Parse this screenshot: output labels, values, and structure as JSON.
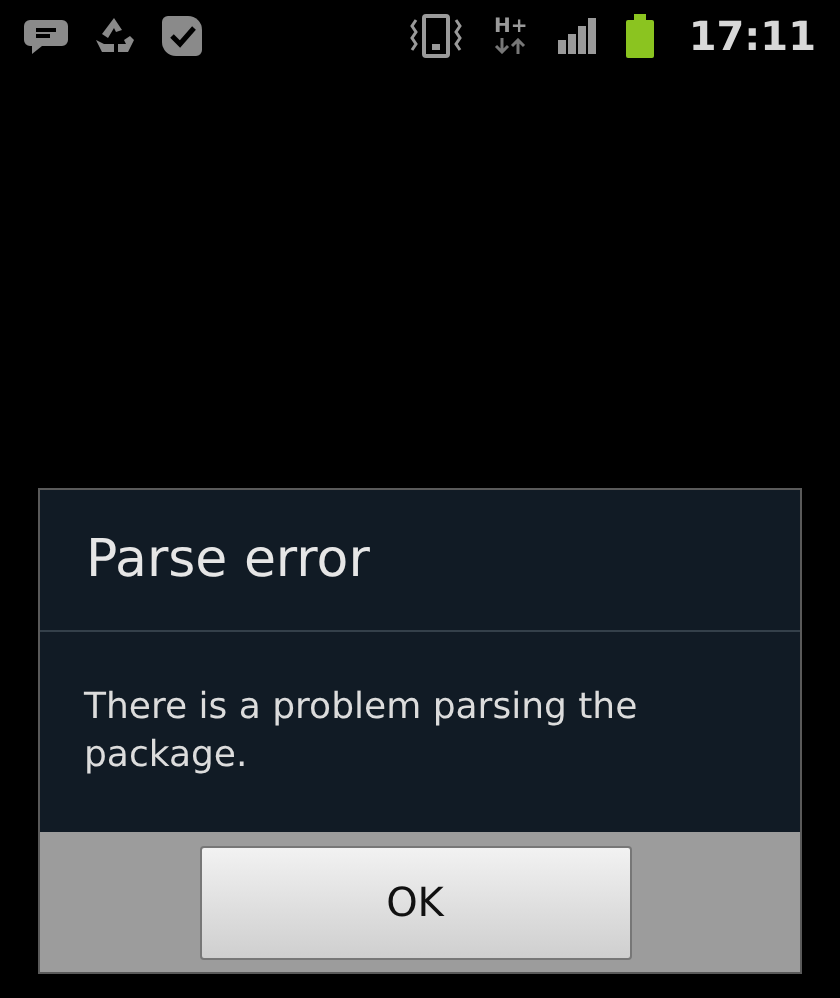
{
  "status_bar": {
    "network_type": "H+",
    "time": "17:11"
  },
  "dialog": {
    "title": "Parse error",
    "message": "There is a problem parsing the package.",
    "buttons": [
      "OK"
    ]
  }
}
